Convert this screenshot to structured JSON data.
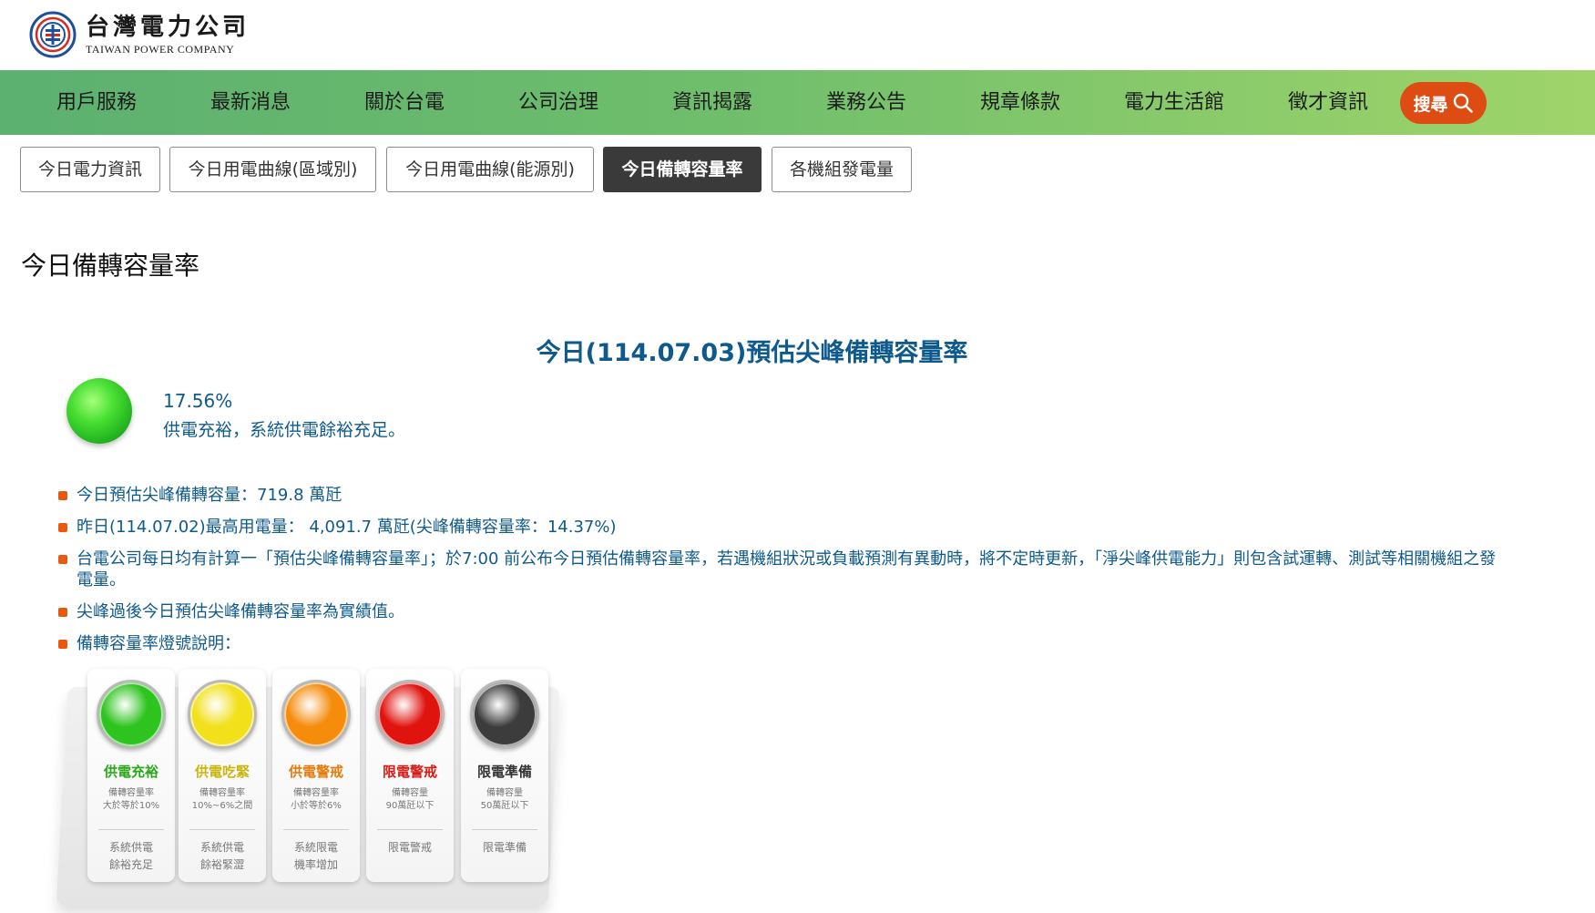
{
  "header": {
    "logo_cn": "台灣電力公司",
    "logo_en": "TAIWAN POWER COMPANY"
  },
  "nav": {
    "items": [
      "用戶服務",
      "最新消息",
      "關於台電",
      "公司治理",
      "資訊揭露",
      "業務公告",
      "規章條款",
      "電力生活館",
      "徵才資訊"
    ],
    "search_label": "搜尋"
  },
  "tabs": [
    {
      "label": "今日電力資訊",
      "active": false
    },
    {
      "label": "今日用電曲線(區域別)",
      "active": false
    },
    {
      "label": "今日用電曲線(能源別)",
      "active": false
    },
    {
      "label": "今日備轉容量率",
      "active": true
    },
    {
      "label": "各機組發電量",
      "active": false
    }
  ],
  "page": {
    "title": "今日備轉容量率",
    "subtitle": "今日(114.07.03)預估尖峰備轉容量率",
    "rate": "17.56%",
    "status_text": "供電充裕，系統供電餘裕充足。",
    "status_color": "#3ad12a"
  },
  "bullets": [
    "今日預估尖峰備轉容量：719.8 萬瓩",
    "昨日(114.07.02)最高用電量： 4,091.7 萬瓩(尖峰備轉容量率：14.37%)",
    "台電公司每日均有計算一「預估尖峰備轉容量率」；於7:00 前公布今日預估備轉容量率，若遇機組狀況或負載預測有異動時，將不定時更新，「淨尖峰供電能力」則包含試運轉、測試等相關機組之發電量。",
    "尖峰過後今日預估尖峰備轉容量率為實績值。",
    "備轉容量率燈號說明："
  ],
  "legend": [
    {
      "name": "供電充裕",
      "cond1": "備轉容量率",
      "cond2": "大於等於10%",
      "meaning1": "系統供電",
      "meaning2": "餘裕充足",
      "color": "#2ec41f",
      "name_color": "#2aa81c"
    },
    {
      "name": "供電吃緊",
      "cond1": "備轉容量率",
      "cond2": "10%~6%之間",
      "meaning1": "系統供電",
      "meaning2": "餘裕緊澀",
      "color": "#f1e01a",
      "name_color": "#c9b50d"
    },
    {
      "name": "供電警戒",
      "cond1": "備轉容量率",
      "cond2": "小於等於6%",
      "meaning1": "系統限電",
      "meaning2": "機率增加",
      "color": "#f58c0c",
      "name_color": "#e67a0a"
    },
    {
      "name": "限電警戒",
      "cond1": "備轉容量",
      "cond2": "90萬瓩以下",
      "meaning1": "限電警戒",
      "meaning2": "",
      "color": "#e0140f",
      "name_color": "#d81a14"
    },
    {
      "name": "限電準備",
      "cond1": "備轉容量",
      "cond2": "50萬瓩以下",
      "meaning1": "限電準備",
      "meaning2": "",
      "color": "#3c3c3c",
      "name_color": "#333333"
    }
  ]
}
